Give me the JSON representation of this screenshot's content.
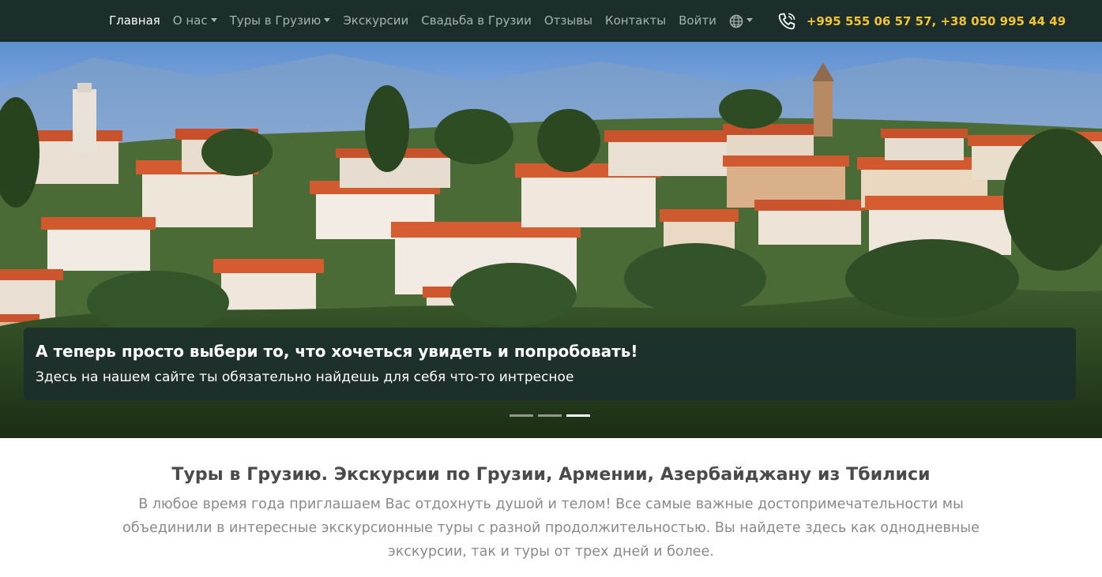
{
  "nav": {
    "items": [
      {
        "label": "Главная",
        "active": true,
        "dropdown": false
      },
      {
        "label": "О нас",
        "active": false,
        "dropdown": true
      },
      {
        "label": "Туры в Грузию",
        "active": false,
        "dropdown": true
      },
      {
        "label": "Экскурсии",
        "active": false,
        "dropdown": false
      },
      {
        "label": "Свадьба в Грузии",
        "active": false,
        "dropdown": false
      },
      {
        "label": "Отзывы",
        "active": false,
        "dropdown": false
      },
      {
        "label": "Контакты",
        "active": false,
        "dropdown": false
      },
      {
        "label": "Войти",
        "active": false,
        "dropdown": false
      }
    ],
    "language_icon": "globe-icon",
    "phone_icon": "phone-icon",
    "phone": "+995 555 06 57 57, +38 050 995 44 49"
  },
  "hero": {
    "caption_title": "А теперь просто выбери то, что хочеться увидеть и попробовать!",
    "caption_subtitle": "Здесь на нашем сайте ты обязательно найдешь для себя что-то интресное",
    "slides_count": 3,
    "active_slide": 3
  },
  "main": {
    "title": "Туры в Грузию. Экскурсии по Грузии, Армении, Азербайджану из Тбилиси",
    "intro": "В любое время года приглашаем Вас отдохнуть душой и телом! Все самые важные достопримечательности мы объединили в интересные экскурсионные туры с разной продолжительностью. Вы найдете здесь как однодневные экскурсии, так и туры от трех дней и более."
  },
  "colors": {
    "navbar_bg": "#1b2e2c",
    "nav_link": "#a7b2b0",
    "nav_active": "#ffffff",
    "phone": "#f4c430",
    "caption_bg": "#1b2e2c"
  }
}
